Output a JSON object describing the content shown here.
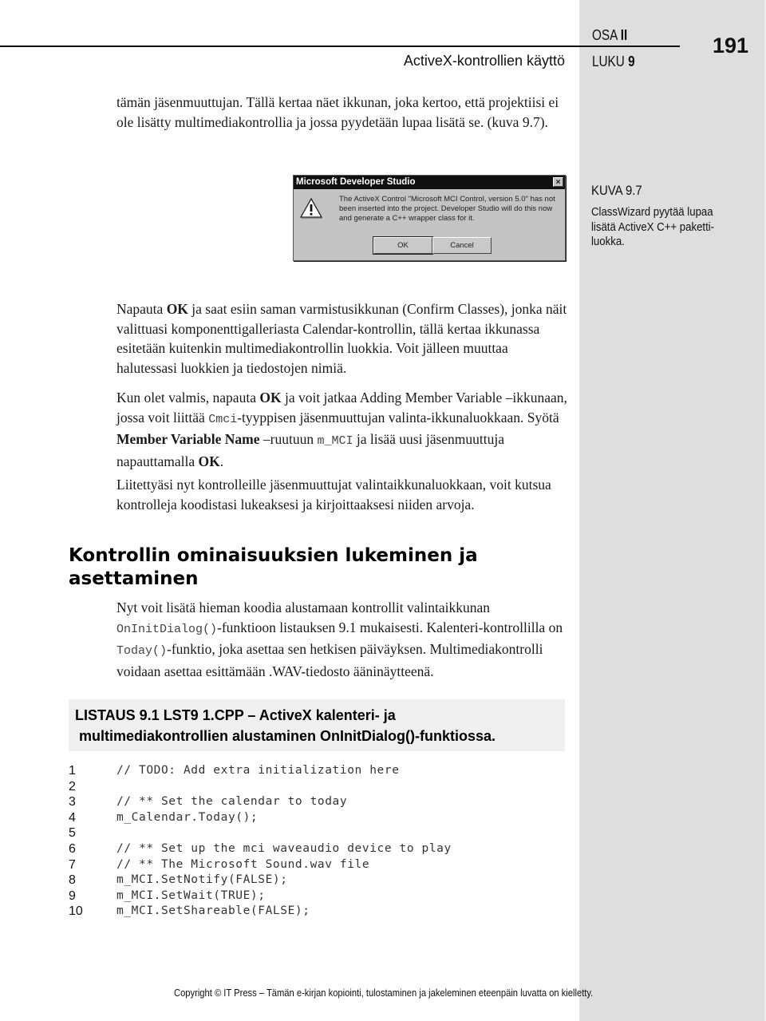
{
  "header": {
    "running_title": "ActiveX-kontrollien käyttö",
    "part_label": "OSA",
    "part_number": "II",
    "chapter_label": "LUKU",
    "chapter_number": "9",
    "page_number": "191"
  },
  "paragraphs": {
    "p1": "tämän jäsenmuuttujan. Tällä kertaa näet ikkunan, joka kertoo, että projektiisi ei ole lisätty multimediakontrollia ja jossa pyydetään lupaa lisätä se. (kuva 9.7).",
    "p2_a": "Napauta ",
    "p2_b": "OK",
    "p2_c": " ja saat esiin saman varmistusikkunan (Confirm Classes), jonka näit valittuasi komponenttigalleriasta Calendar-kontrollin, tällä kertaa ikkunassa esitetään kuitenkin multimediakontrollin luokkia. Voit jälleen muuttaa halutessasi luokkien ja tiedostojen nimiä.",
    "p3_a": "Kun olet valmis, napauta ",
    "p3_b": "OK",
    "p3_c": " ja voit jatkaa Adding Member Variable –ikkunaan, jossa voit liittää ",
    "p3_d": "Cmci",
    "p3_e": "-tyyppisen jäsenmuuttujan valinta-ikkunaluokkaan. Syötä ",
    "p3_f": "Member Variable Name",
    "p3_g": " –ruutuun ",
    "p3_h": "m_MCI",
    "p3_i": " ja lisää uusi jäsenmuuttuja napauttamalla ",
    "p3_j": "OK",
    "p3_k": ".",
    "p4": "Liitettyäsi nyt kontrolleille jäsenmuuttujat valintaikkunaluokkaan, voit kutsua kontrolleja koodistasi lukeaksesi ja kirjoittaaksesi niiden arvoja.",
    "p5_a": "Nyt voit lisätä hieman koodia alustamaan kontrollit valintaikkunan ",
    "p5_b": "OnInitDialog()",
    "p5_c": "-funktioon listauksen 9.1 mukaisesti. Kalenteri-kontrollilla on ",
    "p5_d": "Today()",
    "p5_e": "-funktio, joka asettaa sen hetkisen päiväyksen. Multimediakontrolli voidaan asettaa esittämään .WAV-tiedosto ääninäytteenä."
  },
  "dialog": {
    "title": "Microsoft Developer Studio",
    "close_glyph": "×",
    "icon": "warning-icon",
    "message": "The ActiveX Control \"Microsoft MCI Control, version 5.0\" has not been inserted into the project.  Developer Studio will do this now and generate a C++ wrapper class for it.",
    "ok_label": "OK",
    "cancel_label": "Cancel"
  },
  "figure": {
    "label": "KUVA 9.7",
    "caption": "ClassWizard pyytää lupaa lisätä ActiveX C++ paketti-luokka."
  },
  "section": {
    "heading": "Kontrollin ominaisuuksien lukeminen ja asettaminen"
  },
  "listing": {
    "title_line1": "LISTAUS 9.1  LST9  1.CPP – ActiveX kalenteri- ja",
    "title_line2": "multimediakontrollien alustaminen OnInitDialog()-funktiossa.",
    "lines": [
      {
        "n": "1",
        "code": "// TODO: Add extra initialization here"
      },
      {
        "n": "2",
        "code": ""
      },
      {
        "n": "3",
        "code": "// ** Set the calendar to today"
      },
      {
        "n": "4",
        "code": "m_Calendar.Today();"
      },
      {
        "n": "5",
        "code": ""
      },
      {
        "n": "6",
        "code": "// ** Set up the mci waveaudio device to play"
      },
      {
        "n": "7",
        "code": "// ** The Microsoft Sound.wav file"
      },
      {
        "n": "8",
        "code": "m_MCI.SetNotify(FALSE);"
      },
      {
        "n": "9",
        "code": "m_MCI.SetWait(TRUE);"
      },
      {
        "n": "10",
        "code": "m_MCI.SetShareable(FALSE);"
      }
    ]
  },
  "footer": {
    "copyright": "Copyright © IT Press – Tämän e-kirjan kopiointi, tulostaminen ja jakeleminen eteenpäin luvatta on kielletty."
  }
}
